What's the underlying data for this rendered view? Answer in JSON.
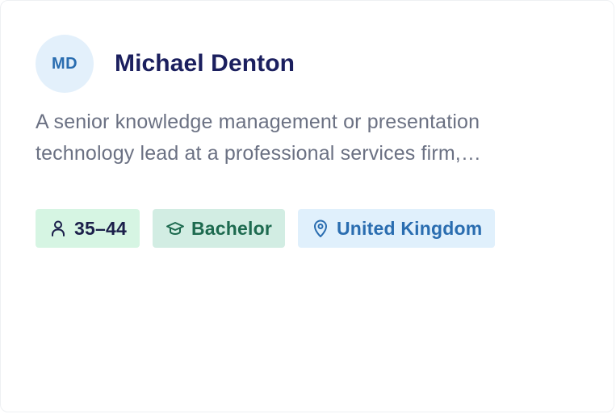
{
  "profile": {
    "initials": "MD",
    "name": "Michael Denton",
    "description_line1": "A senior knowledge management or presentation",
    "description_line2": "technology lead at a professional services firm,…"
  },
  "tags": {
    "age": {
      "label": "35–44",
      "icon": "person-icon"
    },
    "education": {
      "label": "Bachelor",
      "icon": "graduation-cap-icon"
    },
    "location": {
      "label": "United Kingdom",
      "icon": "map-pin-icon"
    }
  },
  "colors": {
    "name": "#1b1f5e",
    "description": "#6b7183",
    "avatar_bg": "#e3f0fb",
    "avatar_text": "#2a6db0",
    "age_bg": "#d6f5e3",
    "education_bg": "#d2ede3",
    "education_text": "#1d6a4f",
    "location_bg": "#e0f0fc",
    "location_text": "#2a6db0"
  }
}
